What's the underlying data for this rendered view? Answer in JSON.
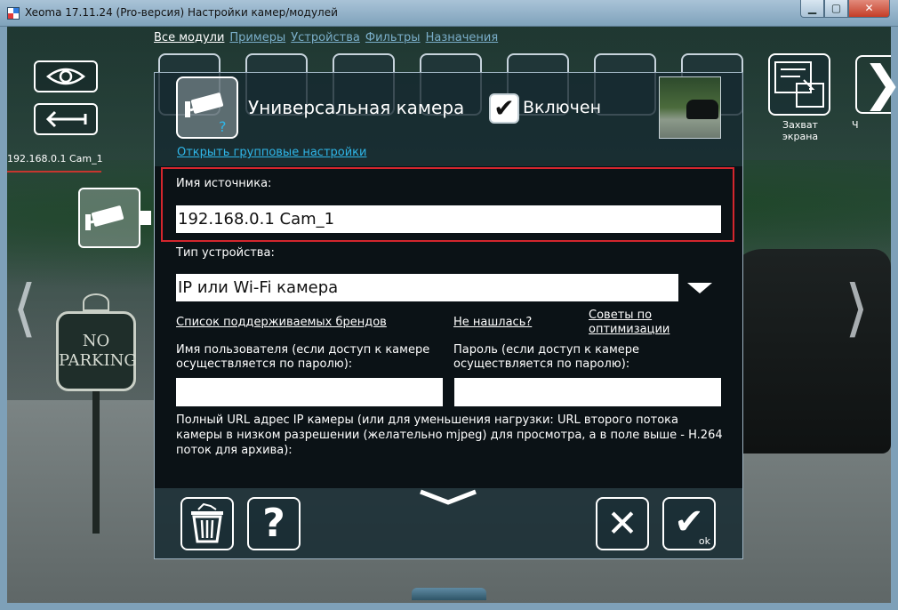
{
  "window": {
    "title": "Xeoma 17.11.24 (Pro-версия) Настройки камер/модулей",
    "min_symbol": "▁",
    "max_symbol": "▢",
    "close_symbol": "✕"
  },
  "nav": {
    "tabs": [
      {
        "label": "Все модули",
        "active": true
      },
      {
        "label": "Примеры",
        "active": false
      },
      {
        "label": "Устройства",
        "active": false
      },
      {
        "label": "Фильтры",
        "active": false
      },
      {
        "label": "Назначения",
        "active": false
      }
    ]
  },
  "sidebar": {
    "camera_label": "192.168.0.1 Cam_1",
    "eye_icon": "eye-icon",
    "back_icon": "back-arrow-icon",
    "camera_icon": "cctv-camera-icon"
  },
  "module_strip": {
    "screen_capture_label": "Захват экрана",
    "next_label_partial": "Ч",
    "next_symbol": "❯"
  },
  "scene": {
    "sign_line1": "NO",
    "sign_line2": "PARKING"
  },
  "dialog": {
    "title": "Универсальная камера",
    "enabled_label": "Включен",
    "enabled_checked": true,
    "check_symbol": "✔",
    "group_settings_link": "Открыть групповые настройки",
    "source_name_label": "Имя источника:",
    "source_name_value": "192.168.0.1 Cam_1",
    "device_type_label": "Тип устройства:",
    "device_type_value": "IP или Wi-Fi камера",
    "brands_link": "Список поддерживаемых брендов",
    "not_found_link": "Не нашлась?",
    "optimization_tips_link": "Советы по оптимизации",
    "username_label": "Имя пользователя (если доступ к камере осуществляется по паролю):",
    "username_value": "",
    "password_label": "Пароль (если доступ к камере осуществляется по паролю):",
    "password_value": "",
    "url_label": "Полный URL адрес IP камеры (или для уменьшения нагрузки: URL второго потока камеры в низком разрешении (желательно mjpeg) для просмотра, а в поле выше - H.264 поток для архива):",
    "help_symbol": "?",
    "cancel_symbol": "✕",
    "ok_symbol": "✔",
    "ok_sub": "ok"
  },
  "colors": {
    "highlight": "#d3262d",
    "link_blue": "#2fb6e8",
    "nav_inactive": "#7aaec9",
    "dialog_body": "#0b1216"
  }
}
